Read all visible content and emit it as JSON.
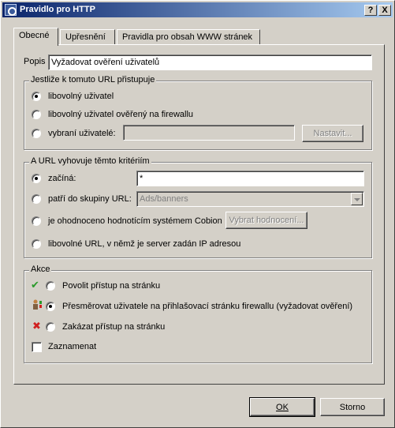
{
  "window": {
    "title": "Pravidlo pro HTTP",
    "help_btn": "?",
    "close_btn": "X"
  },
  "tabs": [
    {
      "label": "Obecné"
    },
    {
      "label": "Upřesnění"
    },
    {
      "label": "Pravidla pro obsah WWW stránek"
    }
  ],
  "popis": {
    "label": "Popis",
    "value": "Vyžadovat ověření uživatelů"
  },
  "group_access": {
    "title": "Jestliže k tomuto URL přistupuje",
    "opt1": "libovolný uživatel",
    "opt2": "libovolný uživatel ověřený na firewallu",
    "opt3": "vybraní uživatelé:",
    "users_value": "",
    "set_button": "Nastavit..."
  },
  "group_url": {
    "title": "A URL vyhovuje těmto kritériím",
    "opt1": "začíná:",
    "opt1_value": "*",
    "opt2": "patří do skupiny URL:",
    "opt2_value": "Ads/banners",
    "opt3": "je ohodnoceno hodnotícím systémem Cobion",
    "rate_button": "Vybrat hodnocení...",
    "opt4": "libovolné URL, v němž je server zadán IP adresou"
  },
  "group_action": {
    "title": "Akce",
    "opt1": "Povolit přístup na stránku",
    "opt2": "Přesměrovat uživatele na přihlašovací stránku firewallu (vyžadovat ověření)",
    "opt3": "Zakázat přístup na stránku",
    "log_label": "Zaznamenat"
  },
  "buttons": {
    "ok": "OK",
    "cancel": "Storno"
  },
  "colors": {
    "allow": "#2a9a2a",
    "deny": "#d02020"
  }
}
